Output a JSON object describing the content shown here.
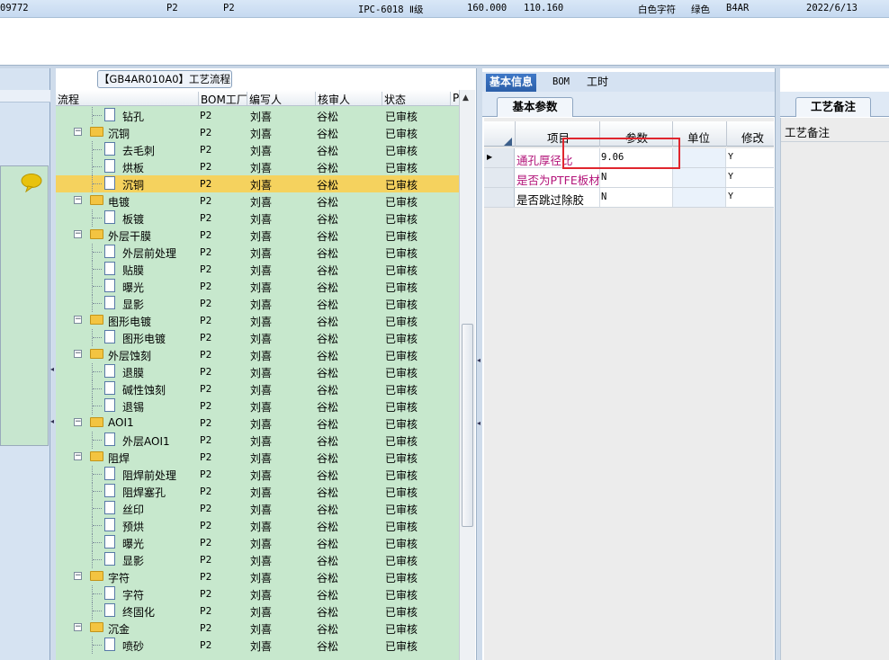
{
  "top_row": {
    "id_fragment": "09772",
    "col1": "P2",
    "col2": "P2",
    "standard": "IPC-6018 Ⅱ级",
    "value1": "160.000",
    "value2": "110.160",
    "char_color": "白色字符",
    "mask_color": "绿色",
    "code": "B4AR",
    "date": "2022/6/13"
  },
  "tree": {
    "title": "【GB4AR010A0】工艺流程",
    "headers": [
      "流程",
      "BOM工厂",
      "编写人",
      "核审人",
      "状态",
      "P"
    ],
    "rows": [
      {
        "name": "钻孔",
        "level": 1,
        "type": "doc",
        "bom": "P2",
        "writer": "刘喜",
        "reviewer": "谷松",
        "status": "已审核"
      },
      {
        "name": "沉铜",
        "level": 0,
        "type": "folder",
        "bom": "P2",
        "writer": "刘喜",
        "reviewer": "谷松",
        "status": "已审核"
      },
      {
        "name": "去毛刺",
        "level": 1,
        "type": "doc",
        "bom": "P2",
        "writer": "刘喜",
        "reviewer": "谷松",
        "status": "已审核"
      },
      {
        "name": "烘板",
        "level": 1,
        "type": "doc",
        "bom": "P2",
        "writer": "刘喜",
        "reviewer": "谷松",
        "status": "已审核"
      },
      {
        "name": "沉铜",
        "level": 1,
        "type": "doc",
        "bom": "P2",
        "writer": "刘喜",
        "reviewer": "谷松",
        "status": "已审核",
        "selected": true
      },
      {
        "name": "电镀",
        "level": 0,
        "type": "folder",
        "bom": "P2",
        "writer": "刘喜",
        "reviewer": "谷松",
        "status": "已审核"
      },
      {
        "name": "板镀",
        "level": 1,
        "type": "doc",
        "bom": "P2",
        "writer": "刘喜",
        "reviewer": "谷松",
        "status": "已审核"
      },
      {
        "name": "外层干膜",
        "level": 0,
        "type": "folder",
        "bom": "P2",
        "writer": "刘喜",
        "reviewer": "谷松",
        "status": "已审核"
      },
      {
        "name": "外层前处理",
        "level": 1,
        "type": "doc",
        "bom": "P2",
        "writer": "刘喜",
        "reviewer": "谷松",
        "status": "已审核"
      },
      {
        "name": "贴膜",
        "level": 1,
        "type": "doc",
        "bom": "P2",
        "writer": "刘喜",
        "reviewer": "谷松",
        "status": "已审核"
      },
      {
        "name": "曝光",
        "level": 1,
        "type": "doc",
        "bom": "P2",
        "writer": "刘喜",
        "reviewer": "谷松",
        "status": "已审核"
      },
      {
        "name": "显影",
        "level": 1,
        "type": "doc",
        "bom": "P2",
        "writer": "刘喜",
        "reviewer": "谷松",
        "status": "已审核"
      },
      {
        "name": "图形电镀",
        "level": 0,
        "type": "folder",
        "bom": "P2",
        "writer": "刘喜",
        "reviewer": "谷松",
        "status": "已审核"
      },
      {
        "name": "图形电镀",
        "level": 1,
        "type": "doc",
        "bom": "P2",
        "writer": "刘喜",
        "reviewer": "谷松",
        "status": "已审核"
      },
      {
        "name": "外层蚀刻",
        "level": 0,
        "type": "folder",
        "bom": "P2",
        "writer": "刘喜",
        "reviewer": "谷松",
        "status": "已审核"
      },
      {
        "name": "退膜",
        "level": 1,
        "type": "doc",
        "bom": "P2",
        "writer": "刘喜",
        "reviewer": "谷松",
        "status": "已审核"
      },
      {
        "name": "碱性蚀刻",
        "level": 1,
        "type": "doc",
        "bom": "P2",
        "writer": "刘喜",
        "reviewer": "谷松",
        "status": "已审核"
      },
      {
        "name": "退锡",
        "level": 1,
        "type": "doc",
        "bom": "P2",
        "writer": "刘喜",
        "reviewer": "谷松",
        "status": "已审核"
      },
      {
        "name": "AOI1",
        "level": 0,
        "type": "folder",
        "bom": "P2",
        "writer": "刘喜",
        "reviewer": "谷松",
        "status": "已审核"
      },
      {
        "name": "外层AOI1",
        "level": 1,
        "type": "doc",
        "bom": "P2",
        "writer": "刘喜",
        "reviewer": "谷松",
        "status": "已审核"
      },
      {
        "name": "阻焊",
        "level": 0,
        "type": "folder",
        "bom": "P2",
        "writer": "刘喜",
        "reviewer": "谷松",
        "status": "已审核"
      },
      {
        "name": "阻焊前处理",
        "level": 1,
        "type": "doc",
        "bom": "P2",
        "writer": "刘喜",
        "reviewer": "谷松",
        "status": "已审核"
      },
      {
        "name": "阻焊塞孔",
        "level": 1,
        "type": "doc",
        "bom": "P2",
        "writer": "刘喜",
        "reviewer": "谷松",
        "status": "已审核"
      },
      {
        "name": "丝印",
        "level": 1,
        "type": "doc",
        "bom": "P2",
        "writer": "刘喜",
        "reviewer": "谷松",
        "status": "已审核"
      },
      {
        "name": "预烘",
        "level": 1,
        "type": "doc",
        "bom": "P2",
        "writer": "刘喜",
        "reviewer": "谷松",
        "status": "已审核"
      },
      {
        "name": "曝光",
        "level": 1,
        "type": "doc",
        "bom": "P2",
        "writer": "刘喜",
        "reviewer": "谷松",
        "status": "已审核"
      },
      {
        "name": "显影",
        "level": 1,
        "type": "doc",
        "bom": "P2",
        "writer": "刘喜",
        "reviewer": "谷松",
        "status": "已审核"
      },
      {
        "name": "字符",
        "level": 0,
        "type": "folder",
        "bom": "P2",
        "writer": "刘喜",
        "reviewer": "谷松",
        "status": "已审核"
      },
      {
        "name": "字符",
        "level": 1,
        "type": "doc",
        "bom": "P2",
        "writer": "刘喜",
        "reviewer": "谷松",
        "status": "已审核"
      },
      {
        "name": "终固化",
        "level": 1,
        "type": "doc",
        "bom": "P2",
        "writer": "刘喜",
        "reviewer": "谷松",
        "status": "已审核"
      },
      {
        "name": "沉金",
        "level": 0,
        "type": "folder",
        "bom": "P2",
        "writer": "刘喜",
        "reviewer": "谷松",
        "status": "已审核"
      },
      {
        "name": "喷砂",
        "level": 1,
        "type": "doc",
        "bom": "P2",
        "writer": "刘喜",
        "reviewer": "谷松",
        "status": "已审核"
      }
    ]
  },
  "info": {
    "tabs": [
      "基本信息",
      "BOM",
      "工时"
    ],
    "subtab": "基本参数",
    "headers": [
      "项目",
      "参数",
      "单位",
      "修改"
    ],
    "rows": [
      {
        "name": "通孔厚径比",
        "value": "9.06",
        "unit": "",
        "mod": "Y",
        "color": "#b3147a"
      },
      {
        "name": "是否为PTFE板材",
        "value": "N",
        "unit": "",
        "mod": "Y",
        "color": "#b3147a"
      },
      {
        "name": "是否跳过除胶",
        "value": "N",
        "unit": "",
        "mod": "Y",
        "color": "#000000"
      }
    ]
  },
  "remarks": {
    "tab": "工艺备注",
    "label": "工艺备注"
  },
  "colors": {
    "tree_bg": "#c7e8cd",
    "selected_row": "#f5d25e",
    "highlight_box": "#e0262e"
  }
}
